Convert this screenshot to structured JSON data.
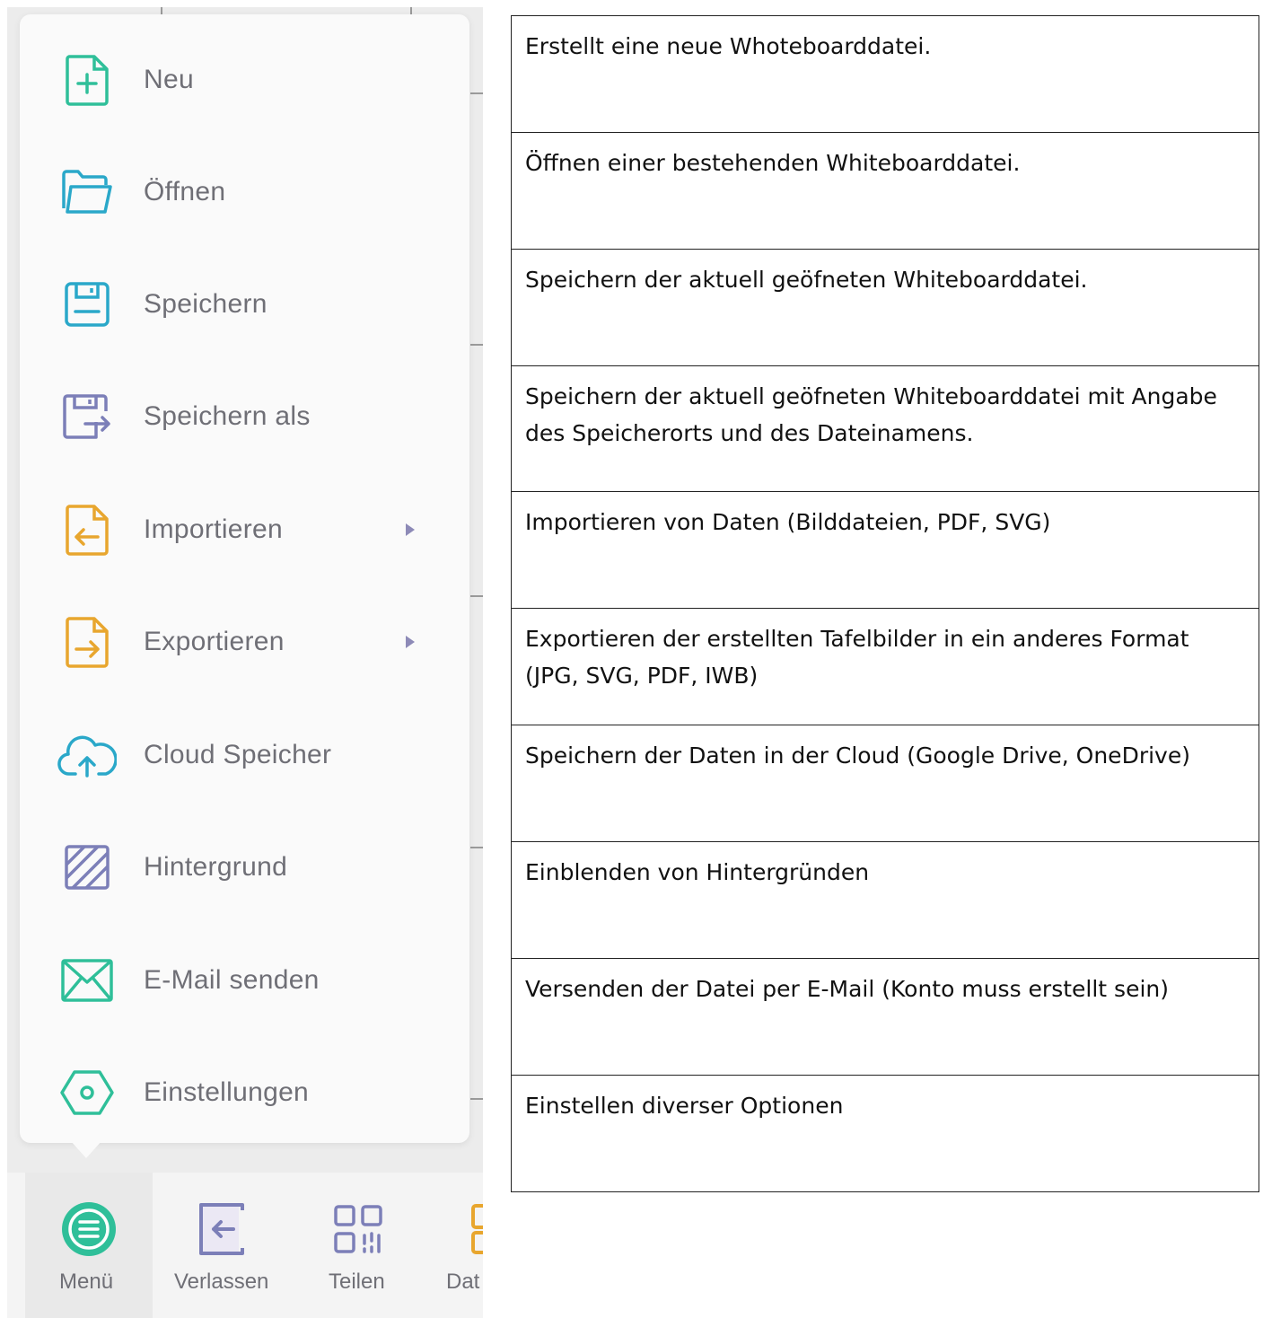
{
  "menu": {
    "items": [
      {
        "label": "Neu",
        "icon": "new-file-icon",
        "color": "#2fbf99",
        "submenu": false
      },
      {
        "label": "Öffnen",
        "icon": "folder-open-icon",
        "color": "#2aa8c9",
        "submenu": false
      },
      {
        "label": "Speichern",
        "icon": "save-icon",
        "color": "#2aa8c9",
        "submenu": false
      },
      {
        "label": "Speichern als",
        "icon": "save-as-icon",
        "color": "#7c7fb8",
        "submenu": false
      },
      {
        "label": "Importieren",
        "icon": "import-icon",
        "color": "#e8a62e",
        "submenu": true
      },
      {
        "label": "Exportieren",
        "icon": "export-icon",
        "color": "#e8a62e",
        "submenu": true
      },
      {
        "label": "Cloud Speicher",
        "icon": "cloud-upload-icon",
        "color": "#2aa8c9",
        "submenu": false
      },
      {
        "label": "Hintergrund",
        "icon": "hatched-background-icon",
        "color": "#7c7fb8",
        "submenu": false
      },
      {
        "label": "E-Mail senden",
        "icon": "envelope-icon",
        "color": "#2fbf99",
        "submenu": false
      },
      {
        "label": "Einstellungen",
        "icon": "settings-hexagon-icon",
        "color": "#2fbf99",
        "submenu": false
      }
    ]
  },
  "toolbar": {
    "items": [
      {
        "label": "Menü",
        "icon": "menu-circle-icon",
        "color": "#2fbf99",
        "active": true
      },
      {
        "label": "Verlassen",
        "icon": "exit-arrow-icon",
        "color": "#7c7fb8",
        "active": false
      },
      {
        "label": "Teilen",
        "icon": "qr-code-icon",
        "color": "#7c7fb8",
        "active": false
      },
      {
        "label": "Dat",
        "icon": "file-icon",
        "color": "#e8a62e",
        "active": false
      }
    ]
  },
  "descriptions": [
    "Erstellt eine neue Whoteboarddatei.",
    "Öffnen einer bestehenden Whiteboarddatei.",
    "Speichern der aktuell geöfneten Whiteboarddatei.",
    "Speichern der aktuell geöfneten Whiteboarddatei mit Angabe des Speicherorts und des Dateinamens.",
    "Importieren von Daten (Bilddateien, PDF, SVG)",
    "Exportieren der erstellten Tafelbilder in ein anderes Format (JPG, SVG, PDF, IWB)",
    "Speichern der Daten in der Cloud (Google Drive, OneDrive)",
    "Einblenden von Hintergründen",
    "Versenden der Datei per E-Mail (Konto muss erstellt sein)",
    "Einstellen diverser Optionen"
  ]
}
